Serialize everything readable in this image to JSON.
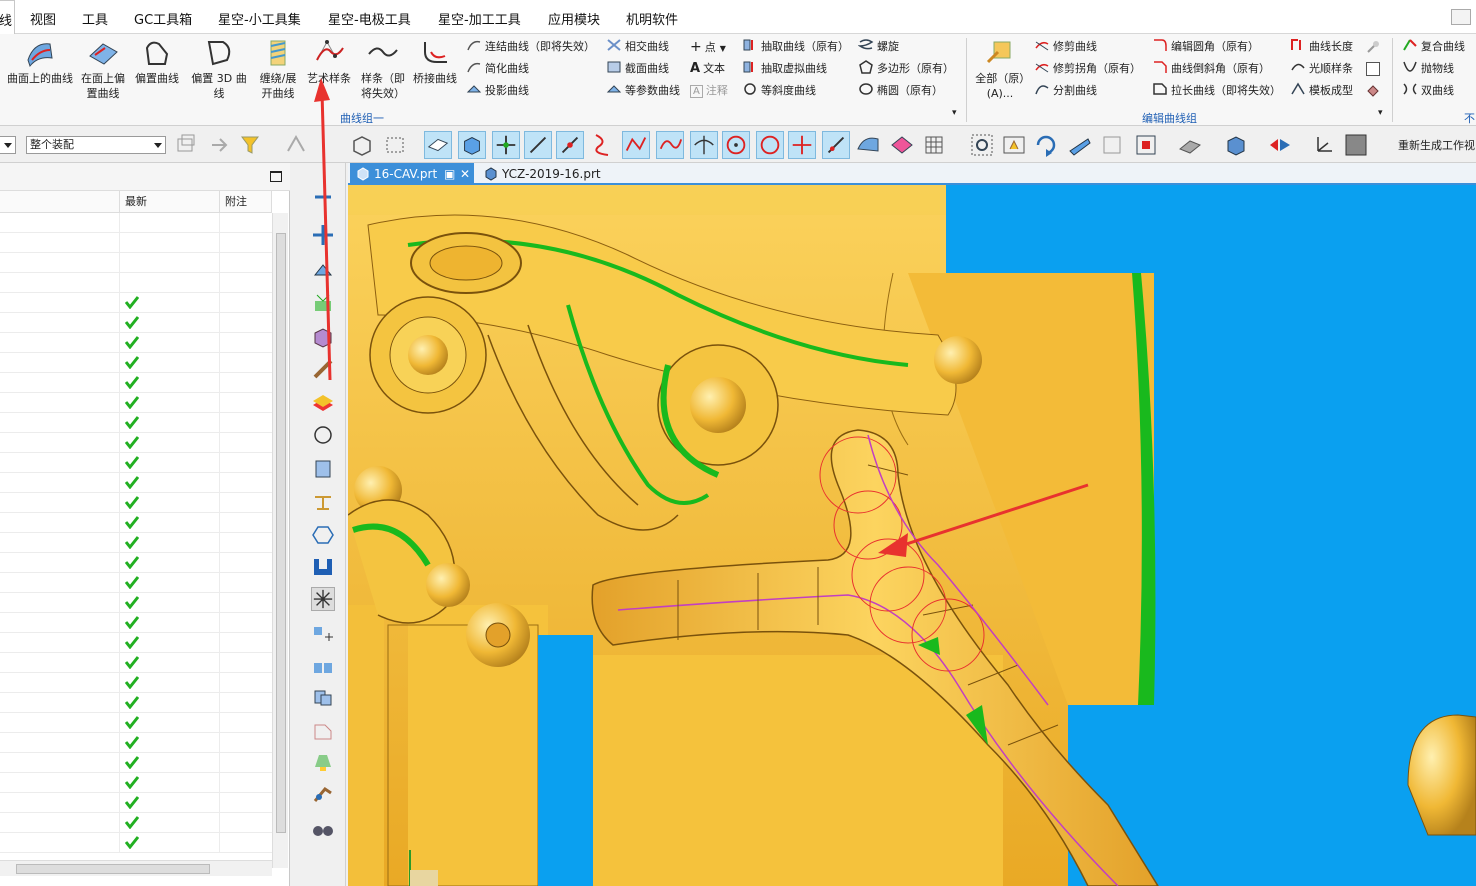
{
  "menu": {
    "items": [
      "线",
      "视图",
      "工具",
      "GC工具箱",
      "星空-小工具集",
      "星空-电极工具",
      "星空-加工工具",
      "应用模块",
      "机明软件"
    ]
  },
  "ribbon": {
    "big_buttons": [
      {
        "label": "曲面上的曲线",
        "icon": "curve-on-surface-icon"
      },
      {
        "label": "在面上偏置曲线",
        "icon": "offset-in-face-icon"
      },
      {
        "label": "偏置曲线",
        "icon": "offset-curve-icon"
      },
      {
        "label": "偏置 3D 曲线",
        "icon": "offset-3d-curve-icon"
      },
      {
        "label": "缠绕/展开曲线",
        "icon": "wrap-unwrap-icon"
      },
      {
        "label": "艺术样条",
        "icon": "studio-spline-icon"
      },
      {
        "label": "样条（即将失效）",
        "icon": "spline-icon"
      },
      {
        "label": "桥接曲线",
        "icon": "bridge-curve-icon"
      }
    ],
    "col1": [
      "连结曲线（即将失效）",
      "简化曲线",
      "投影曲线"
    ],
    "col2": [
      "相交曲线",
      "截面曲线",
      "等参数曲线"
    ],
    "col3": [
      "点",
      "文本",
      "注释"
    ],
    "col4": [
      "抽取曲线（原有）",
      "抽取虚拟曲线",
      "等斜度曲线"
    ],
    "col5": [
      "螺旋",
      "多边形（原有）",
      "椭圆（原有）"
    ],
    "group1_label": "曲线组一",
    "all_button": "全部（原）(A)...",
    "col6": [
      "修剪曲线",
      "修剪拐角（原有）",
      "分割曲线"
    ],
    "col7": [
      "编辑圆角（原有）",
      "曲线倒斜角（原有）",
      "拉长曲线（即将失效）"
    ],
    "col8": [
      "曲线长度",
      "光顺样条",
      "模板成型"
    ],
    "group2_label": "编辑曲线组",
    "col9": [
      "复合曲线",
      "抛物线",
      "双曲线"
    ],
    "overflow_label": "不"
  },
  "toolbar": {
    "filter_value": "",
    "assembly_value": "整个装配",
    "regen_label": "重新生成工作视"
  },
  "navigator": {
    "columns": [
      "",
      "最新",
      "附注"
    ],
    "checked_rows": 28,
    "empty_rows": 4
  },
  "tabs": [
    {
      "label": "16-CAV.prt",
      "active": true
    },
    {
      "label": "YCZ-2019-16.prt",
      "active": false
    }
  ],
  "colors": {
    "part_gold": "#f5c23c",
    "background_blue": "#0aa0f0",
    "face_green": "#1fbf1f",
    "arrow_red": "#e8322e",
    "tab_blue": "#3c8fd9"
  }
}
